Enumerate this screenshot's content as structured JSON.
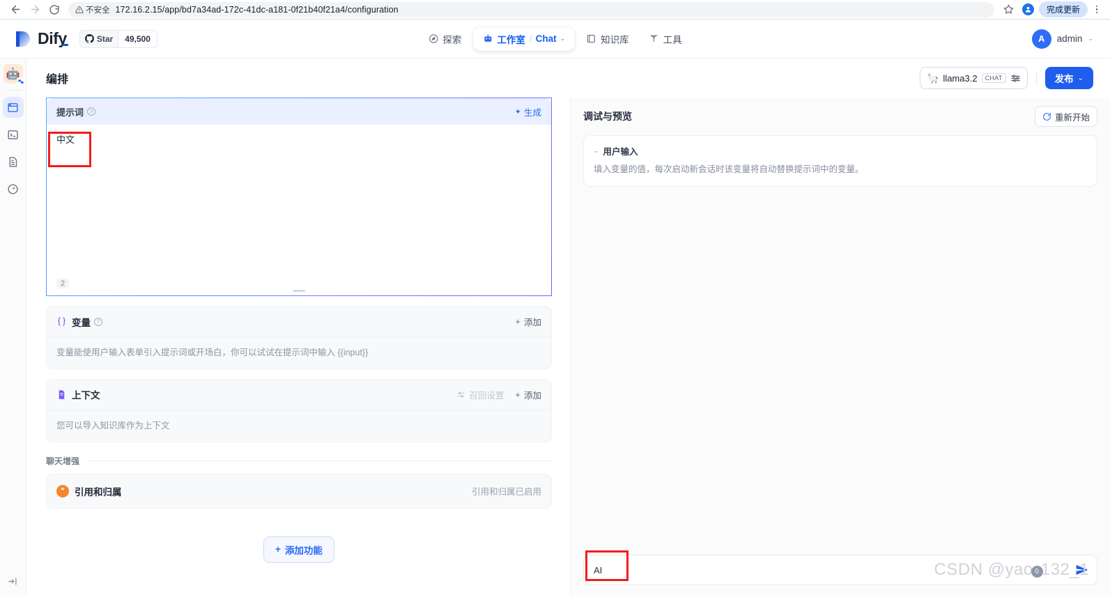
{
  "browser": {
    "back_label": "←",
    "forward_label": "→",
    "reload_label": "⟳",
    "security_label": "不安全",
    "url": "172.16.2.15/app/bd7a34ad-172c-41dc-a181-0f21b40f21a4/configuration",
    "update_button": "完成更新"
  },
  "header": {
    "logo_text": "Dify",
    "github": {
      "label": "Star",
      "count": "49,500"
    },
    "nav": [
      {
        "label": "探索",
        "icon": "compass-icon"
      },
      {
        "label": "工作室",
        "icon": "robot-icon",
        "sub": "Chat",
        "separator": "/"
      },
      {
        "label": "知识库",
        "icon": "book-icon"
      },
      {
        "label": "工具",
        "icon": "hammer-icon"
      }
    ],
    "user": {
      "initial": "A",
      "name": "admin"
    }
  },
  "sidebar": {
    "app_icon": "🤖",
    "items": [
      {
        "name": "orchestrate",
        "icon": "window-icon",
        "active": true
      },
      {
        "name": "api-access",
        "icon": "terminal-icon",
        "active": false
      },
      {
        "name": "logs-annotations",
        "icon": "document-icon",
        "active": false
      },
      {
        "name": "monitoring",
        "icon": "gauge-icon",
        "active": false
      }
    ],
    "expand_label": "展开"
  },
  "main": {
    "title": "编排",
    "model": {
      "name": "llama3.2",
      "badge": "CHAT",
      "icon": "llama-icon"
    },
    "publish": {
      "label": "发布",
      "chevron": "⌄"
    }
  },
  "prompt": {
    "title": "提示词",
    "generate_label": "生成",
    "content": "中文",
    "char_count": "2"
  },
  "variables": {
    "title": "变量",
    "icon_label": "{x}",
    "add_label": "添加",
    "empty_text": "变量能使用户输入表单引入提示词或开场白，你可以试试在提示词中输入 {{input}}"
  },
  "context": {
    "title": "上下文",
    "recall_label": "召回设置",
    "add_label": "添加",
    "empty_text": "您可以导入知识库作为上下文"
  },
  "chat_enhancement": {
    "group_label": "聊天增强",
    "feature_title": "引用和归属",
    "feature_status": "引用和归属已启用"
  },
  "add_feature": {
    "label": "添加功能"
  },
  "debug": {
    "title": "调试与预览",
    "restart_label": "重新开始",
    "user_input": {
      "title": "用户输入",
      "description": "填入变量的值，每次启动新会话时该变量将自动替换提示词中的变量。"
    },
    "chat_input_value": "AI",
    "watermark_prefix": "CSDN @yao",
    "watermark_mid": "132",
    "watermark_suffix": "_1"
  },
  "colors": {
    "accent": "#1f5eed",
    "annotation_red": "#f51b1b",
    "prompt_header_bg": "#eaf0ff",
    "feature_orange": "#f5862b"
  }
}
